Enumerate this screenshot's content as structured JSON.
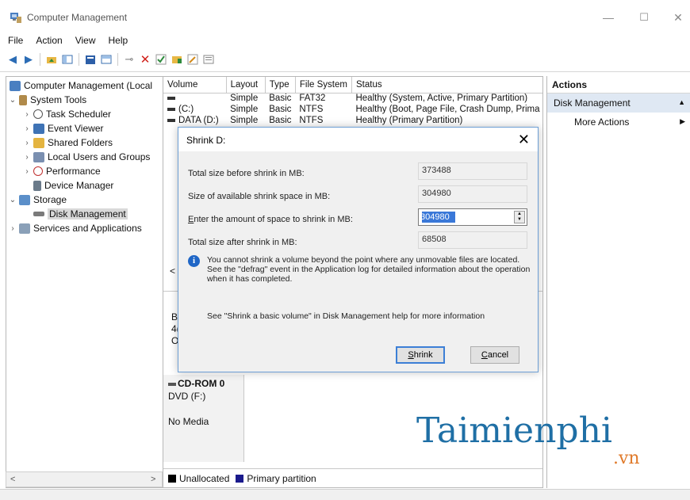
{
  "window": {
    "title": "Computer Management",
    "minimize": "—",
    "maximize": "☐",
    "close": "✕"
  },
  "menu": [
    "File",
    "Action",
    "View",
    "Help"
  ],
  "tree": {
    "root": "Computer Management (Local",
    "system_tools": "System Tools",
    "task_scheduler": "Task Scheduler",
    "event_viewer": "Event Viewer",
    "shared_folders": "Shared Folders",
    "local_users": "Local Users and Groups",
    "performance": "Performance",
    "device_manager": "Device Manager",
    "storage": "Storage",
    "disk_management": "Disk Management",
    "services": "Services and Applications"
  },
  "volumes": {
    "headers": [
      "Volume",
      "Layout",
      "Type",
      "File System",
      "Status"
    ],
    "rows": [
      [
        "",
        "Simple",
        "Basic",
        "FAT32",
        "Healthy (System, Active, Primary Partition)"
      ],
      [
        "(C:)",
        "Simple",
        "Basic",
        "NTFS",
        "Healthy (Boot, Page File, Crash Dump, Prima"
      ],
      [
        "DATA (D:)",
        "Simple",
        "Basic",
        "NTFS",
        "Healthy (Primary Partition)"
      ]
    ]
  },
  "disks": {
    "partial_labels": [
      "B",
      "4(",
      "O"
    ],
    "cdrom_name": "CD-ROM 0",
    "cdrom_drive": "DVD (F:)",
    "cdrom_media": "No Media",
    "left_arrow": "<"
  },
  "legend": {
    "unallocated": "Unallocated",
    "primary": "Primary partition",
    "unallocated_color": "#000000",
    "primary_color": "#1a1a8c"
  },
  "actions": {
    "header": "Actions",
    "section": "Disk Management",
    "more": "More Actions"
  },
  "dialog": {
    "title": "Shrink D:",
    "close": "✕",
    "total_before_label": "Total size before shrink in MB:",
    "total_before_value": "373488",
    "available_label": "Size of available shrink space in MB:",
    "available_value": "304980",
    "enter_label_rest": "nter the amount of space to shrink in MB:",
    "enter_label_accel": "E",
    "enter_value": "304980",
    "after_label": "Total size after shrink in MB:",
    "after_value": "68508",
    "info": "You cannot shrink a volume beyond the point where any unmovable files are located. See the \"defrag\" event in the Application log for detailed information about the operation when it has completed.",
    "see": "See \"Shrink a basic volume\" in Disk Management help for more information",
    "shrink_accel": "S",
    "shrink_rest": "hrink",
    "cancel_accel": "C",
    "cancel_rest": "ancel"
  },
  "watermark": {
    "main": "Taimienphi",
    "suffix": ".vn"
  }
}
